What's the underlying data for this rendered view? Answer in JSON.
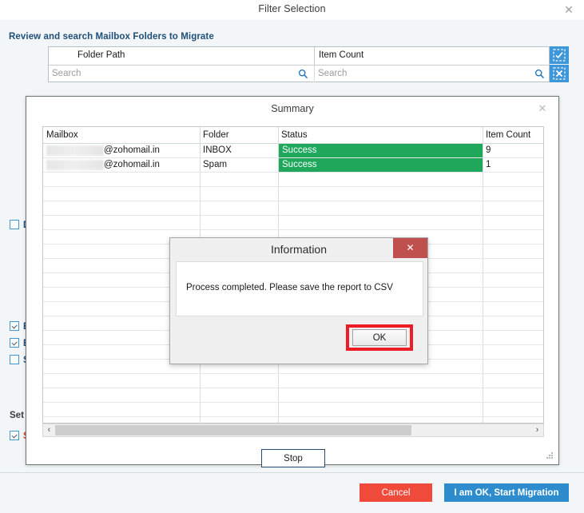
{
  "window": {
    "title": "Filter Selection",
    "close_icon": "✕",
    "section_heading": "Review and search Mailbox Folders to Migrate"
  },
  "background_grid": {
    "columns": [
      "Folder Path",
      "Item Count"
    ],
    "search_placeholders": [
      "Search",
      "Search"
    ],
    "search_icon": "magnifier-icon",
    "tools": [
      {
        "name": "select-all-icon",
        "label": "Select All"
      },
      {
        "name": "deselect-all-icon",
        "label": "Clear Selection"
      }
    ]
  },
  "options": {
    "rows": [
      {
        "label": "D",
        "checked": false,
        "accent": "blue"
      },
      {
        "label": "E",
        "checked": true,
        "accent": "blue"
      },
      {
        "label": "E",
        "checked": true,
        "accent": "blue"
      },
      {
        "label": "S",
        "checked": false,
        "accent": "blue"
      }
    ],
    "set_heading": "Set c",
    "set_row": {
      "label": "S",
      "checked": true,
      "accent": "red"
    }
  },
  "action_bar": {
    "cancel_label": "Cancel",
    "start_label": "I am OK, Start Migration",
    "cancel_color": "#ef4a3a",
    "start_color": "#2d8ccd"
  },
  "summary_dialog": {
    "title": "Summary",
    "close_icon": "✕",
    "columns": [
      "Mailbox",
      "Folder",
      "Status",
      "Item Count"
    ],
    "rows": [
      {
        "mailbox": "@zohomail.in",
        "mailbox_redacted": true,
        "folder": "INBOX",
        "status": "Success",
        "status_color": "#1fa85c",
        "item_count": "9"
      },
      {
        "mailbox": "@zohomail.in",
        "mailbox_redacted": true,
        "folder": "Spam",
        "status": "Success",
        "status_color": "#1fa85c",
        "item_count": "1"
      }
    ],
    "empty_row_count": 18,
    "scrollbar": {
      "left_arrow": "‹",
      "right_arrow": "›"
    },
    "stop_label": "Stop",
    "resize_grip": "resize-grip-icon"
  },
  "information_dialog": {
    "title": "Information",
    "close_icon": "✕",
    "close_color": "#c0504d",
    "message": "Process completed. Please save the report to CSV",
    "ok_label": "OK",
    "highlight_color": "#ee1c25"
  }
}
